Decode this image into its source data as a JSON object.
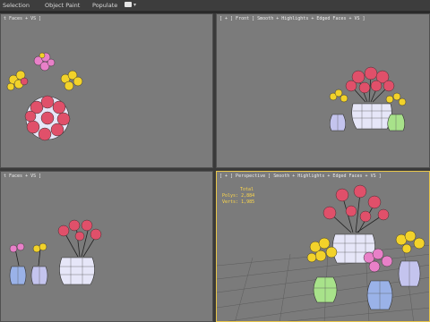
{
  "menu": {
    "tabs": [
      "Selection",
      "Object Paint",
      "Populate"
    ],
    "extra_icon": "toggle-icon",
    "chevron": "▾"
  },
  "viewports": [
    {
      "label": "t Faces + VS ]"
    },
    {
      "label": "[ + ] Front ] Smooth + Highlights + Edged Faces + VS ]"
    },
    {
      "label": "t Faces + VS ]"
    },
    {
      "label": "[ + ] Perspective ] Smooth + Highlights + Edged Faces + VS ]"
    }
  ],
  "stats": {
    "title": "Total",
    "polys_label": "Polys:",
    "polys_value": "2,884",
    "verts_label": "Verts:",
    "verts_value": "1,985"
  },
  "colors": {
    "viewport_bg": "#7b7b7b",
    "active_border": "#e8c64a",
    "stats_text": "#ffd84a",
    "flower_red": "#e0506a",
    "flower_yellow": "#f2d22a",
    "flower_pink": "#e880c8",
    "vase_white": "#e6e6f8",
    "vase_green": "#a8e28a",
    "vase_lavender": "#c4c4ee",
    "vase_blue": "#9ab2e8"
  }
}
